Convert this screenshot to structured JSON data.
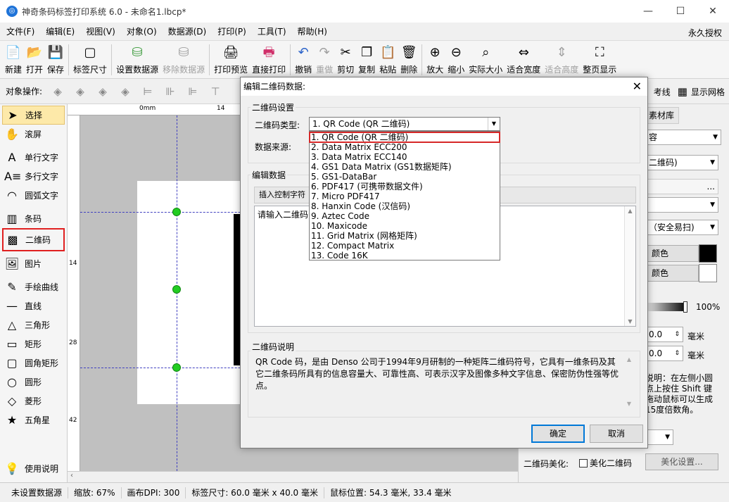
{
  "window": {
    "title": "神奇条码标签打印系统 6.0 - 未命名1.lbcp*",
    "app_icon": "app-logo-icon"
  },
  "menu": {
    "items": [
      "文件(F)",
      "编辑(E)",
      "视图(V)",
      "对象(O)",
      "数据源(D)",
      "打印(P)",
      "工具(T)",
      "帮助(H)"
    ],
    "right_label": "永久授权"
  },
  "toolbar": {
    "new": "新建",
    "open": "打开",
    "save": "保存",
    "label_size": "标签尺寸",
    "set_datasource": "设置数据源",
    "remove_datasource": "移除数据源",
    "print_preview": "打印预览",
    "direct_print": "直接打印",
    "undo": "撤销",
    "redo": "重做",
    "cut": "剪切",
    "copy": "复制",
    "paste": "粘贴",
    "delete": "删除",
    "zoom_in": "放大",
    "zoom_out": "缩小",
    "actual_size": "实际大小",
    "fit_width": "适合宽度",
    "fit_height": "适合高度",
    "full_page": "整页显示"
  },
  "ops": {
    "label": "对象操作:",
    "ref_line": "考线",
    "show_grid": "显示网格"
  },
  "toolbox": {
    "select": "选择",
    "scroll": "滚屏",
    "single_text": "单行文字",
    "multi_text": "多行文字",
    "arc_text": "圆弧文字",
    "barcode": "条码",
    "qrcode": "二维码",
    "image": "图片",
    "freehand": "手绘曲线",
    "line": "直线",
    "triangle": "三角形",
    "rect": "矩形",
    "round_rect": "圆角矩形",
    "circle": "圆形",
    "diamond": "菱形",
    "star": "五角星",
    "help": "使用说明"
  },
  "rulers": {
    "top": [
      "0mm",
      "14"
    ],
    "left": [
      "14",
      "28",
      "42"
    ]
  },
  "right_panel": {
    "tab_material": "素材库",
    "field1": "容",
    "field2": "二维码)",
    "field3": "...",
    "field4": "（安全易扫)",
    "color1_label": "颜色",
    "color1": "#000000",
    "color2_label": "颜色",
    "color2": "#ffffff",
    "opacity": "100%",
    "x_value": "0.0",
    "x_unit": "毫米",
    "y_value": "0.0",
    "y_unit": "毫米",
    "hint_lines": [
      "说明：在左侧小圆",
      "点上按住 Shift 键",
      "拖动鼠标可以生成",
      "15度倍数角。"
    ],
    "beautify_label": "二维码美化:",
    "beautify_checkbox": "美化二维码",
    "beautify_button": "美化设置..."
  },
  "statusbar": {
    "datasource": "未设置数据源",
    "zoom": "缩放: 67%",
    "dpi": "画布DPI: 300",
    "label_size": "标签尺寸: 60.0 毫米 x 40.0 毫米",
    "mouse_pos": "鼠标位置: 54.3 毫米, 33.4 毫米"
  },
  "dialog": {
    "title": "编辑二维码数据:",
    "settings_group": "二维码设置",
    "type_label": "二维码类型:",
    "type_selected": "1.  QR Code (QR 二维码)",
    "source_label": "数据来源:",
    "type_options": [
      "1.  QR Code (QR 二维码)",
      "2.  Data Matrix ECC200",
      "3.  Data Matrix ECC140",
      "4.  GS1 Data Matrix (GS1数据矩阵)",
      "5.  GS1-DataBar",
      "6.  PDF417 (可携带数据文件)",
      "7.  Micro PDF417",
      "8.  Hanxin Code (汉信码)",
      "9.  Aztec Code",
      "10.   Maxicode",
      "11.   Grid Matrix (网格矩阵)",
      "12.   Compact Matrix",
      "13.   Code 16K"
    ],
    "edit_group": "编辑数据",
    "insert_tab": "插入控制字符",
    "edit_placeholder": "请输入二维码",
    "desc_group": "二维码说明",
    "description": "QR Code 码，是由 Denso 公司于1994年9月研制的一种矩阵二维码符号，它具有一维条码及其它二维条码所具有的信息容量大、可靠性高、可表示汉字及图像多种文字信息、保密防伪性强等优点。",
    "ok": "确定",
    "cancel": "取消"
  }
}
